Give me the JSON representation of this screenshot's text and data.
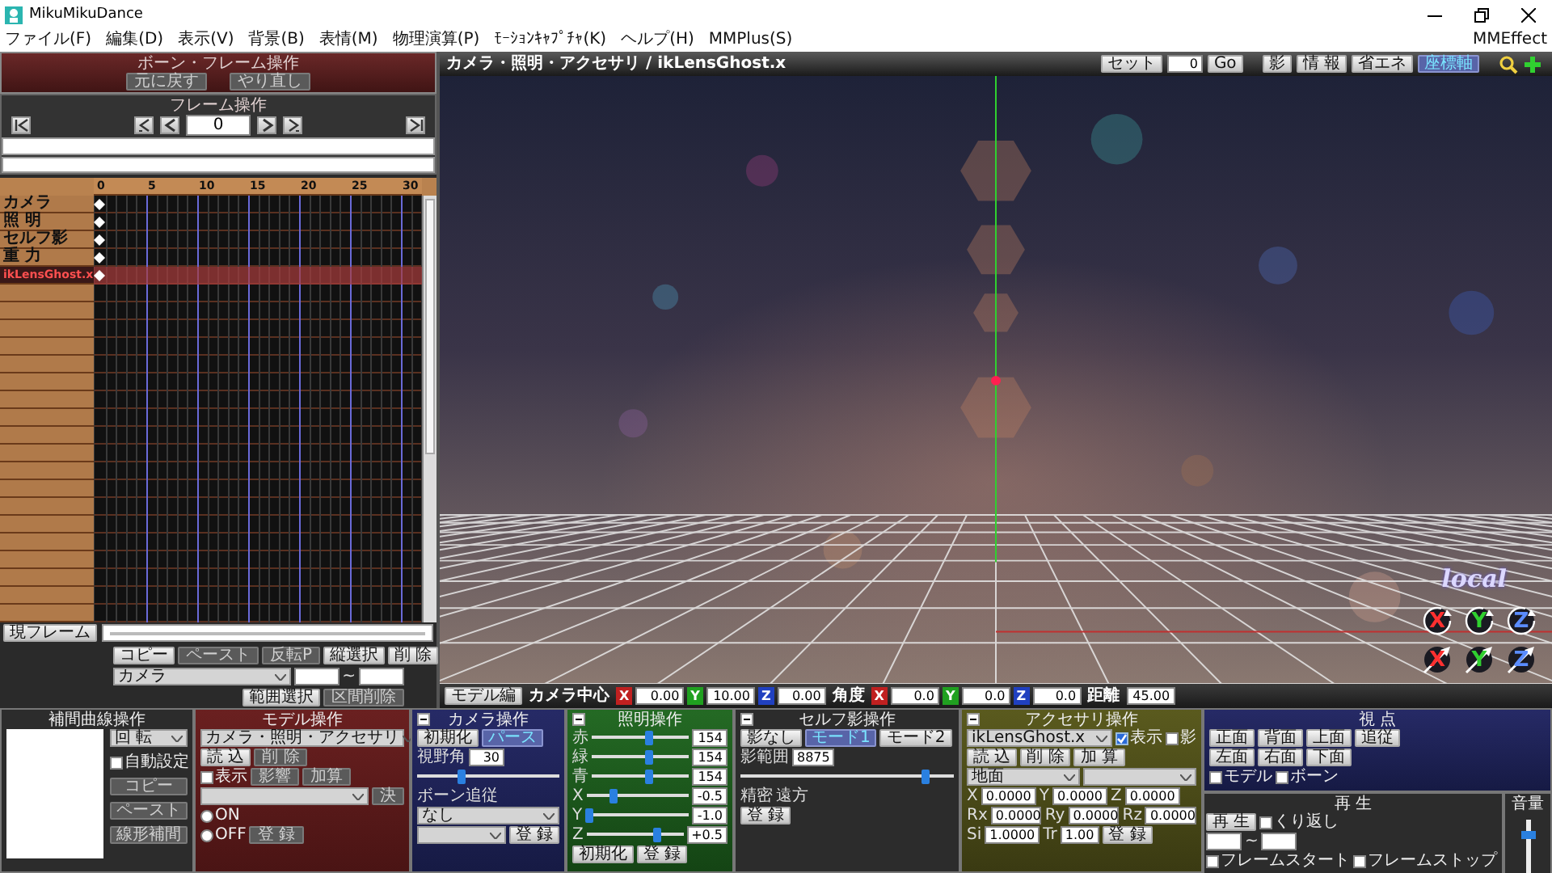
{
  "window": {
    "title": "MikuMikuDance"
  },
  "menu": {
    "items": [
      "ファイル(F)",
      "編集(D)",
      "表示(V)",
      "背景(B)",
      "表情(M)",
      "物理演算(P)",
      "ﾓｰｼｮﾝｷｬﾌﾟﾁｬ(K)",
      "ヘルプ(H)",
      "MMPlus(S)"
    ],
    "right": "MMEffect"
  },
  "bone_frame_panel": {
    "title": "ボーン・フレーム操作",
    "buttons": [
      {
        "kind": "button",
        "label": "元に戻す",
        "disabled": true
      },
      {
        "kind": "button",
        "label": "やり直し",
        "disabled": true
      }
    ]
  },
  "frame_panel": {
    "title": "フレーム操作",
    "frame": "0"
  },
  "timeline": {
    "ticks": [
      "0",
      "5",
      "10",
      "15",
      "20",
      "25",
      "30"
    ],
    "tracks": [
      {
        "name": "カメラ",
        "selected": false,
        "keyframe": true
      },
      {
        "name": "照 明",
        "selected": false,
        "keyframe": true
      },
      {
        "name": "セルフ影",
        "selected": false,
        "keyframe": true
      },
      {
        "name": "重 力",
        "selected": false,
        "keyframe": true
      },
      {
        "name": "ikLensGhost.x",
        "selected": true,
        "keyframe": true
      }
    ],
    "current_frame_button": "現フレーム"
  },
  "frame_tools": [
    [
      {
        "kind": "button",
        "label": "コピー",
        "disabled": false
      },
      {
        "kind": "button",
        "label": "ペースト",
        "disabled": true
      },
      {
        "kind": "button",
        "label": "反転P",
        "disabled": true
      },
      {
        "kind": "button",
        "label": "縦選択",
        "disabled": false
      },
      {
        "kind": "button",
        "label": "削 除",
        "disabled": false
      }
    ],
    [
      {
        "kind": "select",
        "value": "カメラ"
      },
      {
        "kind": "field"
      },
      {
        "kind": "label",
        "label": "~"
      },
      {
        "kind": "field"
      }
    ],
    [
      {
        "kind": "button",
        "label": "範囲選択",
        "disabled": false
      },
      {
        "kind": "button",
        "label": "区間削除",
        "disabled": true
      }
    ]
  ],
  "viewport": {
    "title": "カメラ・照明・アクセサリ / ikLensGhost.x",
    "controls": [
      {
        "kind": "button",
        "label": "セット",
        "disabled": false
      },
      {
        "kind": "field",
        "value": "0"
      },
      {
        "kind": "button",
        "label": "Go",
        "disabled": false
      },
      {
        "kind": "button",
        "label": "影",
        "selected": false
      },
      {
        "kind": "button",
        "label": "情 報",
        "selected": false
      },
      {
        "kind": "button",
        "label": "省エネ",
        "selected": false
      },
      {
        "kind": "button",
        "label": "座標軸",
        "selected": true
      }
    ],
    "mode_label": "local",
    "gizmos": [
      {
        "kind": "rotate",
        "label": "X",
        "color": "#ff3030"
      },
      {
        "kind": "rotate",
        "label": "Y",
        "color": "#30d030"
      },
      {
        "kind": "rotate",
        "label": "Z",
        "color": "#5a8cff"
      },
      {
        "kind": "move",
        "label": "X",
        "color": "#ff3030"
      },
      {
        "kind": "move",
        "label": "Y",
        "color": "#30d030"
      },
      {
        "kind": "move",
        "label": "Z",
        "color": "#5a8cff"
      }
    ],
    "status": [
      {
        "kind": "button",
        "label": "モデル編",
        "disabled": false
      },
      {
        "kind": "label",
        "label": "カメラ中心"
      },
      {
        "kind": "axis",
        "label": "X",
        "color": "#c02020"
      },
      {
        "kind": "field",
        "value": "0.00"
      },
      {
        "kind": "axis",
        "label": "Y",
        "color": "#20a020"
      },
      {
        "kind": "field",
        "value": "10.00"
      },
      {
        "kind": "axis",
        "label": "Z",
        "color": "#2040c0"
      },
      {
        "kind": "field",
        "value": "0.00"
      },
      {
        "kind": "label",
        "label": "角度"
      },
      {
        "kind": "axis",
        "label": "X",
        "color": "#c02020"
      },
      {
        "kind": "field",
        "value": "0.0"
      },
      {
        "kind": "axis",
        "label": "Y",
        "color": "#20a020"
      },
      {
        "kind": "field",
        "value": "0.0"
      },
      {
        "kind": "axis",
        "label": "Z",
        "color": "#2040c0"
      },
      {
        "kind": "field",
        "value": "0.0"
      },
      {
        "kind": "label",
        "label": "距離"
      },
      {
        "kind": "field",
        "value": "45.00"
      }
    ]
  },
  "bottom": {
    "columns": [
      [
        {
          "kind": "interp",
          "title": "補間曲線操作",
          "lines": [
            [
              {
                "kind": "select",
                "value": "回 転"
              }
            ],
            [
              {
                "kind": "check",
                "label": "自動設定",
                "checked": false
              }
            ],
            [
              {
                "kind": "button",
                "label": "コピー",
                "disabled": true
              }
            ],
            [
              {
                "kind": "button",
                "label": "ペースト",
                "disabled": true
              }
            ],
            [
              {
                "kind": "button",
                "label": "線形補間",
                "disabled": true
              }
            ]
          ]
        }
      ],
      [
        {
          "kind": "model",
          "title": "モデル操作",
          "lines": [
            [
              {
                "kind": "select",
                "value": "カメラ・照明・アクセサリ"
              }
            ],
            [
              {
                "kind": "button",
                "label": "読 込",
                "disabled": false
              },
              {
                "kind": "button",
                "label": "削 除",
                "disabled": true
              }
            ],
            [
              {
                "kind": "check",
                "label": "表示",
                "checked": false
              },
              {
                "kind": "button",
                "label": "影響",
                "disabled": true
              },
              {
                "kind": "button",
                "label": "加算",
                "disabled": true
              }
            ],
            [
              {
                "kind": "select"
              },
              {
                "kind": "button",
                "label": "決",
                "disabled": true
              }
            ],
            [
              {
                "kind": "radio",
                "label": "ON",
                "selected": false
              }
            ],
            [
              {
                "kind": "radio",
                "label": "OFF",
                "selected": false
              },
              {
                "kind": "button",
                "label": "登 録",
                "disabled": true
              }
            ]
          ]
        }
      ],
      [
        {
          "kind": "camera",
          "title": "カメラ操作",
          "lines": [
            [
              {
                "kind": "button",
                "label": "初期化",
                "disabled": false
              },
              {
                "kind": "button",
                "label": "パース",
                "selected": true
              }
            ],
            [
              {
                "kind": "label",
                "label": "視野角"
              },
              {
                "kind": "field",
                "value": "30"
              }
            ],
            [
              {
                "kind": "slider",
                "level": 0.3
              }
            ],
            [
              {
                "kind": "label",
                "label": "ボーン追従"
              }
            ],
            [
              {
                "kind": "select",
                "value": "なし"
              }
            ],
            [
              {
                "kind": "select"
              },
              {
                "kind": "button",
                "label": "登 録",
                "disabled": false
              }
            ]
          ]
        }
      ],
      [
        {
          "kind": "light",
          "title": "照明操作",
          "lines": [
            [
              {
                "kind": "label",
                "label": "赤"
              },
              {
                "kind": "slider",
                "level": 0.6
              },
              {
                "kind": "field",
                "value": "154"
              }
            ],
            [
              {
                "kind": "label",
                "label": "緑"
              },
              {
                "kind": "slider",
                "level": 0.6
              },
              {
                "kind": "field",
                "value": "154"
              }
            ],
            [
              {
                "kind": "label",
                "label": "青"
              },
              {
                "kind": "slider",
                "level": 0.6
              },
              {
                "kind": "field",
                "value": "154"
              }
            ],
            [
              {
                "kind": "label",
                "label": "X"
              },
              {
                "kind": "slider",
                "level": 0.25
              },
              {
                "kind": "field",
                "value": "-0.5"
              }
            ],
            [
              {
                "kind": "label",
                "label": "Y"
              },
              {
                "kind": "slider",
                "level": 0.0
              },
              {
                "kind": "field",
                "value": "-1.0"
              }
            ],
            [
              {
                "kind": "label",
                "label": "Z"
              },
              {
                "kind": "slider",
                "level": 0.75
              },
              {
                "kind": "field",
                "value": "+0.5"
              }
            ],
            [
              {
                "kind": "button",
                "label": "初期化",
                "disabled": false
              },
              {
                "kind": "button",
                "label": "登 録",
                "disabled": false
              }
            ]
          ]
        }
      ],
      [
        {
          "kind": "shadow",
          "title": "セルフ影操作",
          "lines": [
            [
              {
                "kind": "button",
                "label": "影なし",
                "selected": false
              },
              {
                "kind": "button",
                "label": "モード1",
                "selected": true
              },
              {
                "kind": "button",
                "label": "モード2",
                "selected": false
              }
            ],
            [
              {
                "kind": "label",
                "label": "影範囲"
              },
              {
                "kind": "field",
                "value": "8875"
              }
            ],
            [
              {
                "kind": "slider",
                "level": 0.88
              }
            ],
            [
              {
                "kind": "label",
                "label": "精密"
              },
              {
                "kind": "label",
                "label": "遠方"
              }
            ],
            [
              {
                "kind": "button",
                "label": "登 録",
                "disabled": false
              }
            ]
          ]
        }
      ],
      [
        {
          "kind": "accessory",
          "title": "アクセサリ操作",
          "lines": [
            [
              {
                "kind": "select",
                "value": "ikLensGhost.x"
              },
              {
                "kind": "check",
                "label": "表示",
                "checked": true
              },
              {
                "kind": "check",
                "label": "影",
                "checked": false
              }
            ],
            [
              {
                "kind": "button",
                "label": "読 込",
                "disabled": false
              },
              {
                "kind": "button",
                "label": "削 除",
                "disabled": false
              },
              {
                "kind": "button",
                "label": "加 算",
                "disabled": false
              }
            ],
            [
              {
                "kind": "select",
                "value": "地面"
              },
              {
                "kind": "select"
              }
            ],
            [
              {
                "kind": "label",
                "label": "X"
              },
              {
                "kind": "field",
                "value": "0.0000"
              },
              {
                "kind": "label",
                "label": "Y"
              },
              {
                "kind": "field",
                "value": "0.0000"
              },
              {
                "kind": "label",
                "label": "Z"
              },
              {
                "kind": "field",
                "value": "0.0000"
              }
            ],
            [
              {
                "kind": "label",
                "label": "Rx"
              },
              {
                "kind": "field",
                "value": "0.0000"
              },
              {
                "kind": "label",
                "label": "Ry"
              },
              {
                "kind": "field",
                "value": "0.0000"
              },
              {
                "kind": "label",
                "label": "Rz"
              },
              {
                "kind": "field",
                "value": "0.0000"
              }
            ],
            [
              {
                "kind": "label",
                "label": "Si"
              },
              {
                "kind": "field",
                "value": "1.0000"
              },
              {
                "kind": "label",
                "label": "Tr"
              },
              {
                "kind": "field",
                "value": "1.00"
              },
              {
                "kind": "button",
                "label": "登 録",
                "disabled": false
              }
            ]
          ]
        }
      ],
      [
        {
          "kind": "view",
          "title": "視 点",
          "lines": [
            [
              {
                "kind": "button",
                "label": "正面",
                "disabled": false
              },
              {
                "kind": "button",
                "label": "背面",
                "disabled": false
              },
              {
                "kind": "button",
                "label": "上面",
                "disabled": false
              },
              {
                "kind": "button",
                "label": "追従",
                "disabled": false
              }
            ],
            [
              {
                "kind": "button",
                "label": "左面",
                "disabled": false
              },
              {
                "kind": "button",
                "label": "右面",
                "disabled": false
              },
              {
                "kind": "button",
                "label": "下面",
                "disabled": false
              }
            ],
            [
              {
                "kind": "check",
                "label": "モデル",
                "checked": false
              },
              {
                "kind": "check",
                "label": "ボーン",
                "checked": false
              }
            ]
          ]
        },
        [
          {
            "kind": "play",
            "title": "再 生",
            "lines": [
              [
                {
                  "kind": "button",
                  "label": "再 生",
                  "disabled": false
                },
                {
                  "kind": "check",
                  "label": "くり返し",
                  "checked": false
                }
              ],
              [
                {
                  "kind": "field"
                },
                {
                  "kind": "label",
                  "label": "~"
                },
                {
                  "kind": "field"
                }
              ],
              [
                {
                  "kind": "check",
                  "label": "フレームスタート",
                  "checked": false
                },
                {
                  "kind": "check",
                  "label": "フレームストップ",
                  "checked": false
                }
              ]
            ]
          },
          {
            "kind": "volume",
            "title": "音量",
            "lines": [
              [
                {
                  "kind": "vslider",
                  "level": 0.85
                }
              ]
            ]
          }
        ]
      ]
    ]
  }
}
